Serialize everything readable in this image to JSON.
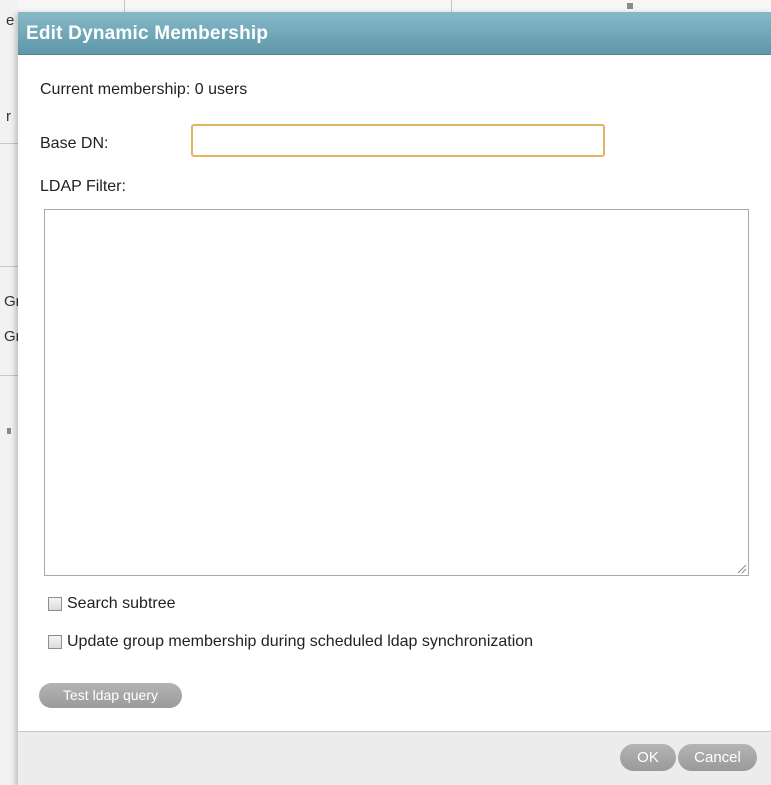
{
  "dialog": {
    "title": "Edit Dynamic Membership",
    "header_color": "#6fa6b6",
    "membership_text": "Current membership: 0 users",
    "base_dn": {
      "label": "Base DN:",
      "value": "",
      "placeholder": ""
    },
    "ldap_filter": {
      "label": "LDAP Filter:",
      "value": ""
    },
    "checkboxes": [
      {
        "label": "Search subtree",
        "checked": false
      },
      {
        "label": "Update group membership during scheduled ldap synchronization",
        "checked": false
      }
    ],
    "test_button_label": "Test ldap query",
    "footer": {
      "ok_label": "OK",
      "cancel_label": "Cancel"
    }
  },
  "background_fragments": {
    "frag1": "e",
    "frag2": "r",
    "frag3": "Gr",
    "frag4": "Gr"
  }
}
